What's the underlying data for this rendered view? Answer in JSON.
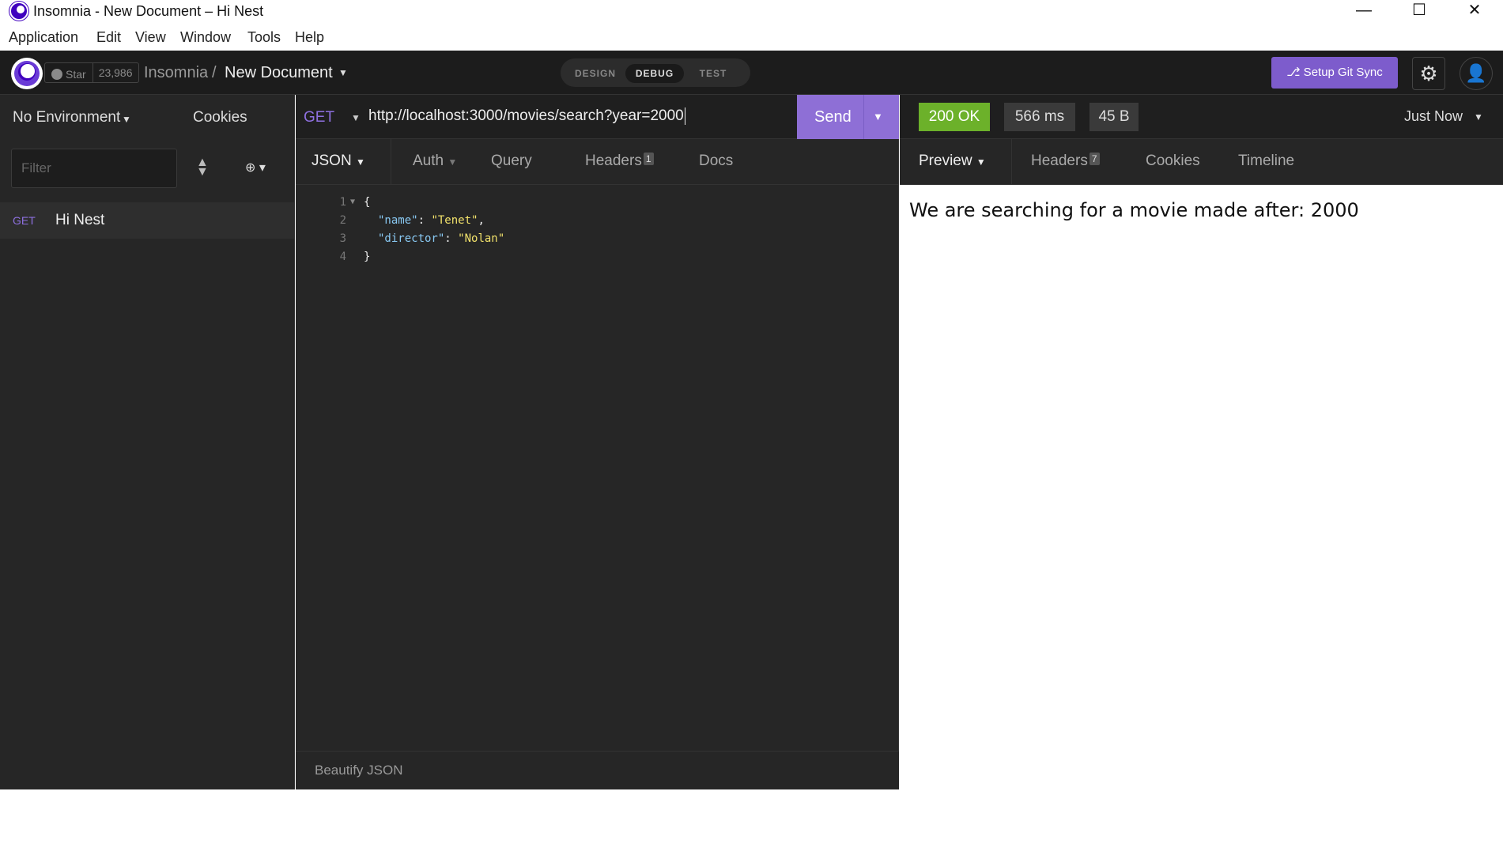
{
  "window": {
    "title": "Insomnia - New Document – Hi Nest",
    "minimize": "—",
    "maximize": "☐",
    "close": "✕"
  },
  "menu": [
    "Application",
    "Edit",
    "View",
    "Window",
    "Tools",
    "Help"
  ],
  "header": {
    "star_label": "Star",
    "star_count": "23,986",
    "breadcrumb_root": "Insomnia",
    "breadcrumb_sep": "/",
    "breadcrumb_doc": "New Document",
    "modes": [
      "DESIGN",
      "DEBUG",
      "TEST"
    ],
    "active_mode": "DEBUG",
    "git_button": "⎇ Setup Git Sync",
    "icons": {
      "settings": "gear-icon",
      "account": "account-icon",
      "github": "github-icon"
    },
    "accent_color": "#7d5ccc"
  },
  "sidebar": {
    "environment": "No Environment",
    "cookies": "Cookies",
    "filter_placeholder": "Filter",
    "requests": [
      {
        "method": "GET",
        "name": "Hi Nest"
      }
    ]
  },
  "request": {
    "method": "GET",
    "url": "http://localhost:3000/movies/search?year=2000",
    "send_label": "Send",
    "tabs": [
      {
        "label": "JSON",
        "active": true
      },
      {
        "label": "Auth"
      },
      {
        "label": "Query"
      },
      {
        "label": "Headers",
        "badge": "1"
      },
      {
        "label": "Docs"
      }
    ],
    "body_lines": [
      {
        "num": "1",
        "open": "{"
      },
      {
        "num": "2",
        "key": "\"name\"",
        "colon": ": ",
        "val": "\"Tenet\"",
        "trail": ","
      },
      {
        "num": "3",
        "key": "\"director\"",
        "colon": ": ",
        "val": "\"Nolan\"",
        "trail": ""
      },
      {
        "num": "4",
        "close": "}"
      }
    ],
    "beautify_label": "Beautify JSON"
  },
  "response": {
    "status": "200 OK",
    "status_color": "#6cb12a",
    "time": "566 ms",
    "size": "45 B",
    "when": "Just Now",
    "tabs": [
      {
        "label": "Preview",
        "active": true
      },
      {
        "label": "Headers",
        "badge": "7"
      },
      {
        "label": "Cookies"
      },
      {
        "label": "Timeline"
      }
    ],
    "preview": "We are searching for a movie made after: 2000"
  }
}
